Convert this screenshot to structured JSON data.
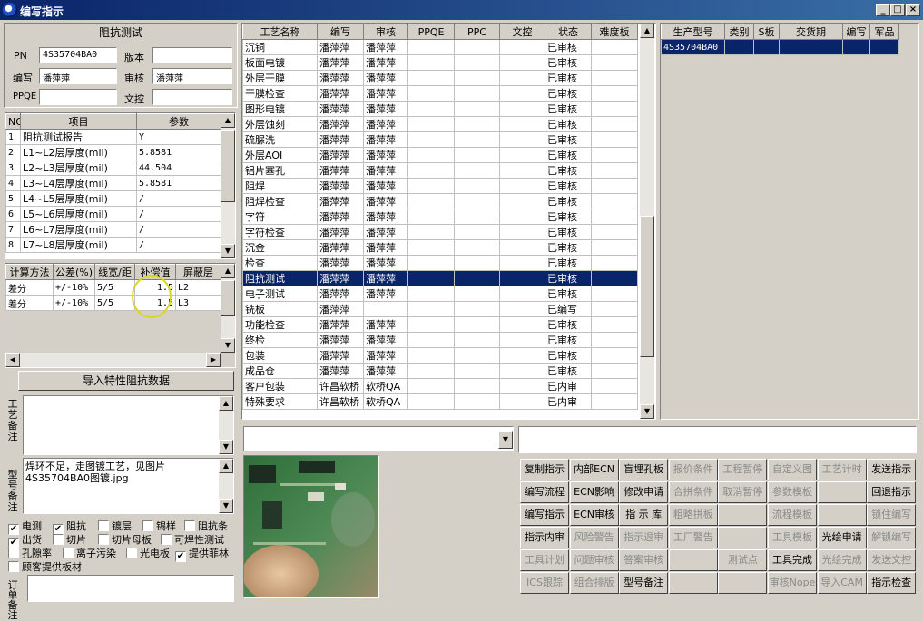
{
  "window": {
    "title": "编写指示",
    "min": "_",
    "max": "□",
    "close": "×"
  },
  "left": {
    "header": "阻抗测试",
    "fields": {
      "pn_label": "PN",
      "pn_value": "4S35704BA0",
      "version_label": "版本",
      "version_value": "",
      "writer_label": "编写",
      "writer_value": "潘萍萍",
      "reviewer_label": "审核",
      "reviewer_value": "潘萍萍",
      "ppqe_label": "PPQE",
      "ppqe_value": "",
      "doc_label": "文控",
      "doc_value": ""
    },
    "param_table": {
      "headers": [
        "NO",
        "项目",
        "参数"
      ],
      "rows": [
        [
          "1",
          "阻抗测试报告",
          "Y"
        ],
        [
          "2",
          "L1~L2层厚度(mil)",
          "5.8581"
        ],
        [
          "3",
          "L2~L3层厚度(mil)",
          "44.504"
        ],
        [
          "4",
          "L3~L4层厚度(mil)",
          "5.8581"
        ],
        [
          "5",
          "L4~L5层厚度(mil)",
          "/"
        ],
        [
          "6",
          "L5~L6层厚度(mil)",
          "/"
        ],
        [
          "7",
          "L6~L7层厚度(mil)",
          "/"
        ],
        [
          "8",
          "L7~L8层厚度(mil)",
          "/"
        ]
      ]
    },
    "calc_table": {
      "headers": [
        "计算方法",
        "公差(%)",
        "线宽/距",
        "补偿值",
        "屏蔽层"
      ],
      "rows": [
        [
          "差分",
          "+/-10%",
          "5/5",
          "1.5",
          "L2"
        ],
        [
          "差分",
          "+/-10%",
          "5/5",
          "1.5",
          "L3"
        ]
      ]
    },
    "import_button": "导入特性阻抗数据",
    "process_note_label": "工艺备注",
    "process_note": "",
    "model_note_label": "型号备注",
    "model_note": "焊环不足，走图镀工艺，见图片\n4S35704BA0图镀.jpg",
    "checkboxes": [
      {
        "label": "电测",
        "checked": true
      },
      {
        "label": "阻抗",
        "checked": true
      },
      {
        "label": "镀层",
        "checked": false
      },
      {
        "label": "锡样",
        "checked": false
      },
      {
        "label": "阻抗条",
        "checked": false
      },
      {
        "label": "出货",
        "checked": true
      },
      {
        "label": "切片",
        "checked": false
      },
      {
        "label": "切片母板",
        "checked": false
      },
      {
        "label": "可焊性测试",
        "checked": false
      },
      {
        "label": "孔隙率",
        "checked": false
      },
      {
        "label": "离子污染",
        "checked": false
      },
      {
        "label": "光电板",
        "checked": false
      },
      {
        "label": "提供菲林",
        "checked": true
      },
      {
        "label": "顾客提供板材",
        "checked": false
      }
    ],
    "order_note_label": "订单备注"
  },
  "process_table": {
    "headers": [
      "工艺名称",
      "编写",
      "审核",
      "PPQE",
      "PPC",
      "文控",
      "状态",
      "难度板"
    ],
    "rows": [
      [
        "沉铜",
        "潘萍萍",
        "潘萍萍",
        "",
        "",
        "",
        "已审核",
        ""
      ],
      [
        "板面电镀",
        "潘萍萍",
        "潘萍萍",
        "",
        "",
        "",
        "已审核",
        ""
      ],
      [
        "外层干膜",
        "潘萍萍",
        "潘萍萍",
        "",
        "",
        "",
        "已审核",
        ""
      ],
      [
        "干膜检查",
        "潘萍萍",
        "潘萍萍",
        "",
        "",
        "",
        "已审核",
        ""
      ],
      [
        "图形电镀",
        "潘萍萍",
        "潘萍萍",
        "",
        "",
        "",
        "已审核",
        ""
      ],
      [
        "外层蚀刻",
        "潘萍萍",
        "潘萍萍",
        "",
        "",
        "",
        "已审核",
        ""
      ],
      [
        "硫脲洗",
        "潘萍萍",
        "潘萍萍",
        "",
        "",
        "",
        "已审核",
        ""
      ],
      [
        "外层AOI",
        "潘萍萍",
        "潘萍萍",
        "",
        "",
        "",
        "已审核",
        ""
      ],
      [
        "铝片塞孔",
        "潘萍萍",
        "潘萍萍",
        "",
        "",
        "",
        "已审核",
        ""
      ],
      [
        "阻焊",
        "潘萍萍",
        "潘萍萍",
        "",
        "",
        "",
        "已审核",
        ""
      ],
      [
        "阻焊检查",
        "潘萍萍",
        "潘萍萍",
        "",
        "",
        "",
        "已审核",
        ""
      ],
      [
        "字符",
        "潘萍萍",
        "潘萍萍",
        "",
        "",
        "",
        "已审核",
        ""
      ],
      [
        "字符检查",
        "潘萍萍",
        "潘萍萍",
        "",
        "",
        "",
        "已审核",
        ""
      ],
      [
        "沉金",
        "潘萍萍",
        "潘萍萍",
        "",
        "",
        "",
        "已审核",
        ""
      ],
      [
        "检查",
        "潘萍萍",
        "潘萍萍",
        "",
        "",
        "",
        "已审核",
        ""
      ],
      [
        "阻抗测试",
        "潘萍萍",
        "潘萍萍",
        "",
        "",
        "",
        "已审核",
        ""
      ],
      [
        "电子测试",
        "潘萍萍",
        "潘萍萍",
        "",
        "",
        "",
        "已审核",
        ""
      ],
      [
        "铣板",
        "潘萍萍",
        "",
        "",
        "",
        "",
        "已编写",
        ""
      ],
      [
        "功能检查",
        "潘萍萍",
        "潘萍萍",
        "",
        "",
        "",
        "已审核",
        ""
      ],
      [
        "终检",
        "潘萍萍",
        "潘萍萍",
        "",
        "",
        "",
        "已审核",
        ""
      ],
      [
        "包装",
        "潘萍萍",
        "潘萍萍",
        "",
        "",
        "",
        "已审核",
        ""
      ],
      [
        "成品仓",
        "潘萍萍",
        "潘萍萍",
        "",
        "",
        "",
        "已审核",
        ""
      ],
      [
        "客户包装",
        "许昌软桥",
        "软桥QA",
        "",
        "",
        "",
        "已内审",
        ""
      ],
      [
        "特殊要求",
        "许昌软桥",
        "软桥QA",
        "",
        "",
        "",
        "已内审",
        ""
      ]
    ],
    "selected": 15
  },
  "model_table": {
    "headers": [
      "生产型号",
      "类别",
      "S板",
      "交货期",
      "编写",
      "军品"
    ],
    "rows": [
      [
        "4S35704BA0",
        "",
        "",
        "",
        "",
        ""
      ]
    ]
  },
  "combo_left": "",
  "combo_right": "",
  "buttons": [
    [
      {
        "l": "复制指示",
        "e": 1
      },
      {
        "l": "内部ECN",
        "e": 1
      },
      {
        "l": "盲埋孔板",
        "e": 1
      },
      {
        "l": "报价条件",
        "e": 0
      },
      {
        "l": "工程暂停",
        "e": 0
      },
      {
        "l": "自定义图",
        "e": 0
      },
      {
        "l": "工艺计时",
        "e": 0
      },
      {
        "l": "发送指示",
        "e": 1
      }
    ],
    [
      {
        "l": "编写流程",
        "e": 1
      },
      {
        "l": "ECN影响",
        "e": 1
      },
      {
        "l": "修改申请",
        "e": 1
      },
      {
        "l": "合拼条件",
        "e": 0
      },
      {
        "l": "取消暂停",
        "e": 0
      },
      {
        "l": "参数模板",
        "e": 0
      },
      {
        "l": "",
        "e": 0
      },
      {
        "l": "回退指示",
        "e": 1
      }
    ],
    [
      {
        "l": "编写指示",
        "e": 1
      },
      {
        "l": "ECN审核",
        "e": 1
      },
      {
        "l": "指 示 库",
        "e": 1
      },
      {
        "l": "粗略拼板",
        "e": 0
      },
      {
        "l": "",
        "e": 0
      },
      {
        "l": "流程模板",
        "e": 0
      },
      {
        "l": "",
        "e": 0
      },
      {
        "l": "锁住编写",
        "e": 0
      }
    ],
    [
      {
        "l": "指示内审",
        "e": 1
      },
      {
        "l": "风险警告",
        "e": 0
      },
      {
        "l": "指示退审",
        "e": 0
      },
      {
        "l": "工厂警告",
        "e": 0
      },
      {
        "l": "",
        "e": 0
      },
      {
        "l": "工具模板",
        "e": 0
      },
      {
        "l": "光绘申请",
        "e": 1
      },
      {
        "l": "解锁编写",
        "e": 0
      }
    ],
    [
      {
        "l": "工具计划",
        "e": 0
      },
      {
        "l": "问题审核",
        "e": 0
      },
      {
        "l": "答案审核",
        "e": 0
      },
      {
        "l": "",
        "e": 0
      },
      {
        "l": "测试点",
        "e": 0
      },
      {
        "l": "工具完成",
        "e": 1
      },
      {
        "l": "光绘完成",
        "e": 0
      },
      {
        "l": "发送文控",
        "e": 0
      }
    ],
    [
      {
        "l": "ICS跟踪",
        "e": 0
      },
      {
        "l": "组合排版",
        "e": 0
      },
      {
        "l": "型号备注",
        "e": 1
      },
      {
        "l": "",
        "e": 0
      },
      {
        "l": "",
        "e": 0
      },
      {
        "l": "审核Nope",
        "e": 0
      },
      {
        "l": "导入CAM",
        "e": 0
      },
      {
        "l": "指示检查",
        "e": 1
      }
    ]
  ]
}
